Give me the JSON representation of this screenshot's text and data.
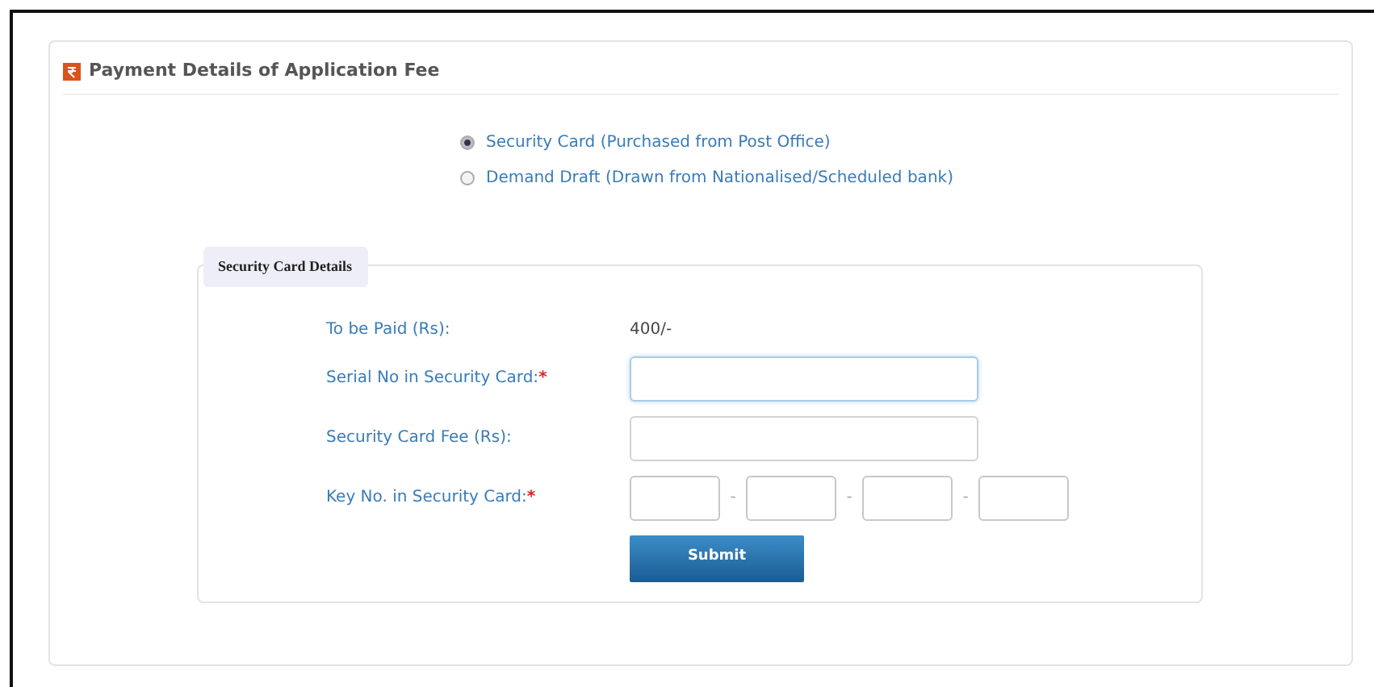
{
  "panel": {
    "title": "Payment Details of Application Fee"
  },
  "payment_options": [
    {
      "label": "Security Card (Purchased from Post Office)",
      "selected": true
    },
    {
      "label": "Demand Draft (Drawn from Nationalised/Scheduled bank)",
      "selected": false
    }
  ],
  "fieldset": {
    "legend": "Security Card Details",
    "rows": [
      {
        "kind": "text",
        "label": "To be Paid (Rs):",
        "value": "400/-"
      },
      {
        "kind": "input",
        "label": "Serial No in Security Card:",
        "required_mark": "*",
        "focused": true
      },
      {
        "kind": "input",
        "label": "Security Card Fee (Rs):",
        "focused": false
      },
      {
        "kind": "split",
        "label": "Key No. in Security Card:",
        "required_mark": "*",
        "separators": [
          "-",
          "-",
          "-"
        ]
      }
    ],
    "submit": "Submit"
  }
}
